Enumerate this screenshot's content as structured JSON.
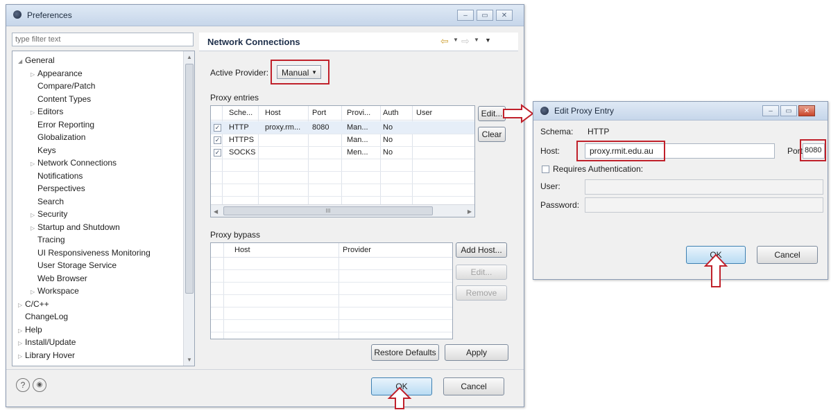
{
  "prefs": {
    "title": "Preferences",
    "filter_placeholder": "type filter text",
    "tree": [
      {
        "label": "General",
        "level": 0,
        "tri": "open"
      },
      {
        "label": "Appearance",
        "level": 1,
        "tri": "closed"
      },
      {
        "label": "Compare/Patch",
        "level": 1,
        "tri": ""
      },
      {
        "label": "Content Types",
        "level": 1,
        "tri": ""
      },
      {
        "label": "Editors",
        "level": 1,
        "tri": "closed"
      },
      {
        "label": "Error Reporting",
        "level": 1,
        "tri": ""
      },
      {
        "label": "Globalization",
        "level": 1,
        "tri": ""
      },
      {
        "label": "Keys",
        "level": 1,
        "tri": ""
      },
      {
        "label": "Network Connections",
        "level": 1,
        "tri": "closed"
      },
      {
        "label": "Notifications",
        "level": 1,
        "tri": ""
      },
      {
        "label": "Perspectives",
        "level": 1,
        "tri": ""
      },
      {
        "label": "Search",
        "level": 1,
        "tri": ""
      },
      {
        "label": "Security",
        "level": 1,
        "tri": "closed"
      },
      {
        "label": "Startup and Shutdown",
        "level": 1,
        "tri": "closed"
      },
      {
        "label": "Tracing",
        "level": 1,
        "tri": ""
      },
      {
        "label": "UI Responsiveness Monitoring",
        "level": 1,
        "tri": ""
      },
      {
        "label": "User Storage Service",
        "level": 1,
        "tri": ""
      },
      {
        "label": "Web Browser",
        "level": 1,
        "tri": ""
      },
      {
        "label": "Workspace",
        "level": 1,
        "tri": "closed"
      },
      {
        "label": "C/C++",
        "level": 0,
        "tri": "closed"
      },
      {
        "label": "ChangeLog",
        "level": 0,
        "tri": ""
      },
      {
        "label": "Help",
        "level": 0,
        "tri": "closed"
      },
      {
        "label": "Install/Update",
        "level": 0,
        "tri": "closed"
      },
      {
        "label": "Library Hover",
        "level": 0,
        "tri": "closed"
      }
    ],
    "page_title": "Network Connections",
    "active_provider_label": "Active Provider:",
    "active_provider_value": "Manual",
    "proxy_entries_label": "Proxy entries",
    "entries_headers": [
      "Sche...",
      "Host",
      "Port",
      "Provi...",
      "Auth",
      "User"
    ],
    "entries_rows": [
      [
        "HTTP",
        "proxy.rm...",
        "8080",
        "Man...",
        "No",
        ""
      ],
      [
        "HTTPS",
        "",
        "",
        "Man...",
        "No",
        ""
      ],
      [
        "SOCKS",
        "",
        "",
        "Men...",
        "No",
        ""
      ]
    ],
    "edit_label": "Edit...",
    "clear_label": "Clear",
    "proxy_bypass_label": "Proxy bypass",
    "bypass_headers": [
      "Host",
      "Provider"
    ],
    "add_host_label": "Add Host...",
    "bypass_edit_label": "Edit...",
    "remove_label": "Remove",
    "restore_defaults_label": "Restore Defaults",
    "apply_label": "Apply",
    "ok_label": "OK",
    "cancel_label": "Cancel",
    "scroll_mark": "III"
  },
  "edit_entry": {
    "title": "Edit Proxy Entry",
    "schema_label": "Schema:",
    "schema_value": "HTTP",
    "host_label": "Host:",
    "host_value": "proxy.rmit.edu.au",
    "port_label": "Port:",
    "port_value": "8080",
    "requires_auth_label": "Requires Authentication:",
    "user_label": "User:",
    "password_label": "Password:",
    "ok_label": "OK",
    "cancel_label": "Cancel"
  },
  "colors": {
    "highlight": "#c0202a"
  }
}
